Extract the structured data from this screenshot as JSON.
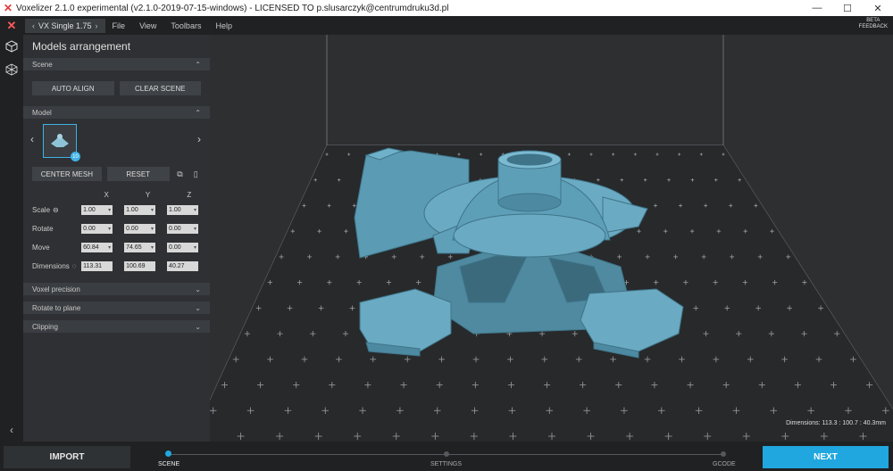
{
  "titlebar": {
    "title": "Voxelizer 2.1.0 experimental (v2.1.0-2019-07-15-windows) - LICENSED TO p.slusarczyk@centrumdruku3d.pl",
    "minimize": "—",
    "maximize": "☐",
    "close": "✕"
  },
  "menubar": {
    "printer": "VX Single 1.75",
    "prev": "‹",
    "next": "›",
    "items": [
      "File",
      "View",
      "Toolbars",
      "Help"
    ],
    "beta_line1": "BETA",
    "beta_line2": "FEEDBACK"
  },
  "panel": {
    "title": "Models arrangement",
    "scene_section": "Scene",
    "auto_align": "AUTO ALIGN",
    "clear_scene": "CLEAR SCENE",
    "model_section": "Model",
    "model_badge": "10",
    "center_mesh": "CENTER MESH",
    "reset": "RESET",
    "axes": [
      "X",
      "Y",
      "Z"
    ],
    "rows": [
      {
        "label": "Scale",
        "values": [
          "1.00",
          "1.00",
          "1.00"
        ]
      },
      {
        "label": "Rotate",
        "values": [
          "0.00",
          "0.00",
          "0.00"
        ]
      },
      {
        "label": "Move",
        "values": [
          "60.84",
          "74.65",
          "0.00"
        ]
      },
      {
        "label": "Dimensions",
        "values": [
          "113.31",
          "100.69",
          "40.27"
        ]
      }
    ],
    "voxel_precision": "Voxel precision",
    "rotate_to_plane": "Rotate to plane",
    "clipping": "Clipping"
  },
  "viewport": {
    "dimensions": "Dimensions: 113.3 : 100.7 : 40.3mm"
  },
  "bottom": {
    "import": "IMPORT",
    "next": "NEXT",
    "steps": [
      "SCENE",
      "SETTINGS",
      "GCODE"
    ]
  },
  "colors": {
    "accent": "#21a7e0",
    "model": "#5b9bb3"
  }
}
